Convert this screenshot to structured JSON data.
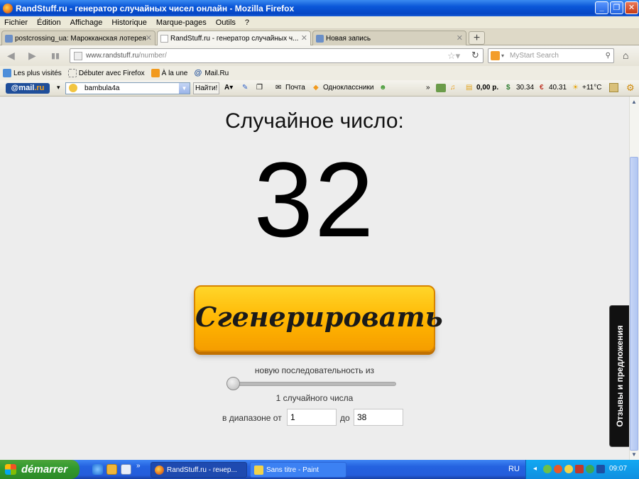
{
  "window": {
    "title": "RandStuff.ru - генератор случайных чисел онлайн - Mozilla Firefox"
  },
  "menu": [
    "Fichier",
    "Édition",
    "Affichage",
    "Historique",
    "Marque-pages",
    "Outils",
    "?"
  ],
  "tabs": [
    {
      "label": "postcrossing_ua: Марокканская лотерея",
      "active": false
    },
    {
      "label": "RandStuff.ru - генератор случайных ч...",
      "active": true
    },
    {
      "label": "Новая запись",
      "active": false
    }
  ],
  "newtab_label": "+",
  "url": {
    "host": "www.randstuff.ru",
    "path": "/number/"
  },
  "search": {
    "placeholder": "MyStart Search"
  },
  "bookmarks": [
    "Les plus visités",
    "Débuter avec Firefox",
    "À la une",
    "Mail.Ru"
  ],
  "mailbar": {
    "logo_prefix": "@mail",
    "logo_suffix": ".ru",
    "user": "bambula4a",
    "find_button": "Найти!",
    "mail_label": "Почта",
    "ok_label": "Одноклассники",
    "money": "0,00 р.",
    "usd": "30.34",
    "eur": "40.31",
    "weather": "+11°C"
  },
  "page": {
    "heading": "Случайное число:",
    "number": "32",
    "generate_button": "Сгенерировать",
    "sequence_label": "новую последовательность из",
    "count_label": "1 случайного числа",
    "range_label": "в диапазоне от",
    "from_value": "1",
    "to_label": "до",
    "to_value": "38",
    "slider_level": 0,
    "feedback_tab": "Отзывы и предложения"
  },
  "taskbar": {
    "start_label": "démarrer",
    "tasks": [
      {
        "label": "RandStuff.ru - генер...",
        "active": true
      },
      {
        "label": "Sans titre - Paint",
        "active": false
      }
    ],
    "language": "RU",
    "clock": "09:07"
  },
  "colors": {
    "button": "#ffb400",
    "title_bar": "#0a57d8",
    "taskbar": "#245ddb",
    "start": "#329a2e"
  }
}
